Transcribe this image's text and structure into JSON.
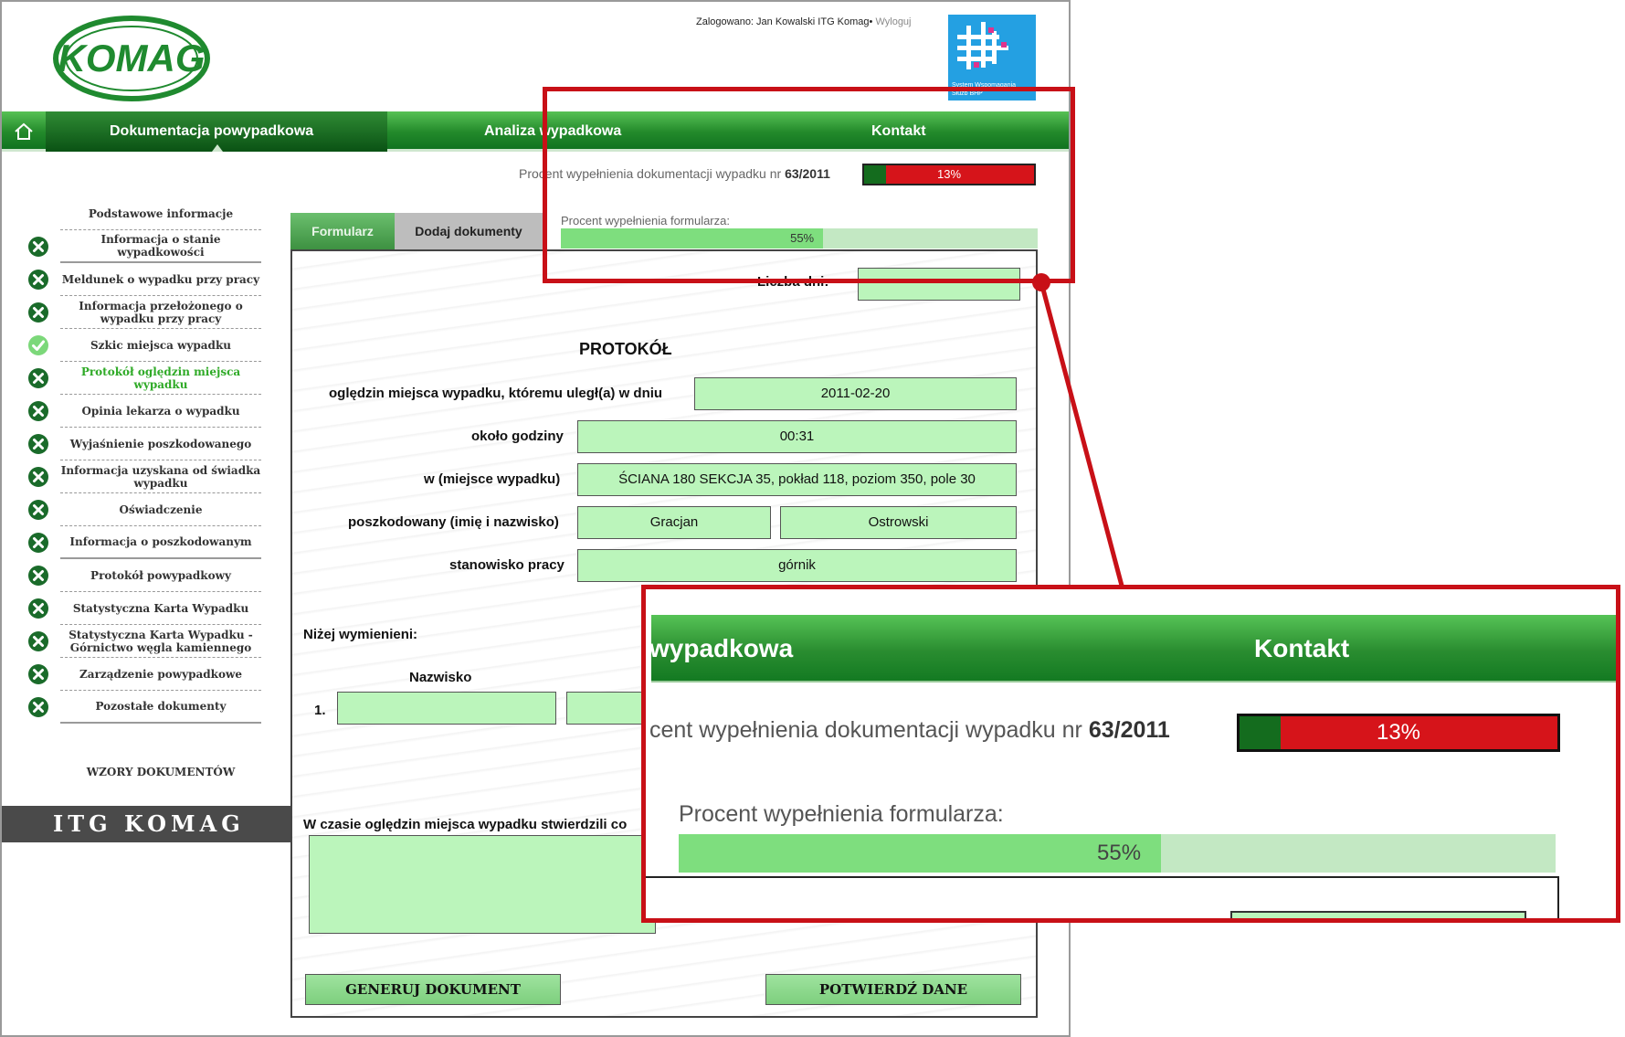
{
  "header": {
    "logo_text": "KOMAG",
    "user_text": "Zalogowano: Jan Kowalski ITG Komag",
    "logout_label": "Wyloguj",
    "system_logo_caption_1": "System Wspomagania",
    "system_logo_caption_2": "Służb BHP"
  },
  "nav": {
    "tabs": [
      {
        "label": "Dokumentacja powypadkowa"
      },
      {
        "label": "Analiza wypadkowa"
      },
      {
        "label": "Kontakt"
      }
    ]
  },
  "doc_progress": {
    "label": "Procent wypełnienia dokumentacji wypadku nr",
    "number": "63/2011",
    "percent_text": "13%",
    "fraction": 0.13
  },
  "sidebar": {
    "items": [
      {
        "label": "Podstawowe informacje",
        "status": "none"
      },
      {
        "label": "Informacja o stanie wypadkowości",
        "status": "x"
      },
      {
        "label": "Meldunek o wypadku przy pracy",
        "status": "x"
      },
      {
        "label": "Informacja przełożonego o wypadku przy pracy",
        "status": "x"
      },
      {
        "label": "Szkic miejsca wypadku",
        "status": "check"
      },
      {
        "label": "Protokół oględzin miejsca wypadku",
        "status": "x"
      },
      {
        "label": "Opinia lekarza o wypadku",
        "status": "x"
      },
      {
        "label": "Wyjaśnienie poszkodowanego",
        "status": "x"
      },
      {
        "label": "Informacja uzyskana od świadka wypadku",
        "status": "x"
      },
      {
        "label": "Oświadczenie",
        "status": "x"
      },
      {
        "label": "Informacja o poszkodowanym",
        "status": "x"
      },
      {
        "label": "Protokół powypadkowy",
        "status": "x"
      },
      {
        "label": "Statystyczna Karta Wypadku",
        "status": "x"
      },
      {
        "label": "Statystyczna Karta Wypadku - Górnictwo węgla kamiennego",
        "status": "x"
      },
      {
        "label": "Zarządzenie powypadkowe",
        "status": "x"
      },
      {
        "label": "Pozostałe dokumenty",
        "status": "x"
      }
    ],
    "wzory_label": "WZORY DOKUMENTÓW",
    "brand_band": "ITG KOMAG"
  },
  "form_tabs": {
    "formularz": "Formularz",
    "dodaj": "Dodaj dokumenty"
  },
  "form_progress": {
    "label": "Procent wypełnienia formularza:",
    "percent_text": "55%",
    "fraction": 0.55
  },
  "form": {
    "liczba_dni_label": "Liczba dni:",
    "liczba_dni_value": "",
    "title": "PROTOKÓŁ",
    "date_label": "oględzin miejsca wypadku, któremu uległ(a) w dniu",
    "date_value": "2011-02-20",
    "time_label": "około godziny",
    "time_value": "00:31",
    "place_label": "w (miejsce wypadku)",
    "place_value": "ŚCIANA 180 SEKCJA 35, pokład 118, poziom 350, pole 30",
    "victim_label": "poszkodowany (imię i nazwisko)",
    "victim_first": "Gracjan",
    "victim_last": "Ostrowski",
    "position_label": "stanowisko pracy",
    "position_value": "górnik",
    "below_label": "Niżej wymienieni:",
    "col_surname": "Nazwisko",
    "row1_index": "1.",
    "row1_surname": "",
    "row1_name": "",
    "findings_label": "W czasie oględzin miejsca wypadku stwierdzili co",
    "findings_value": "",
    "btn_generate": "GENERUJ DOKUMENT",
    "btn_confirm": "POTWIERDŹ DANE"
  },
  "zoom": {
    "tab_fragment": "wypadkowa",
    "tab_kontakt": "Kontakt",
    "doc_label_fragment": "cent wypełnienia dokumentacji wypadku nr",
    "doc_number": "63/2011",
    "doc_percent": "13%",
    "form_label": "Procent wypełnienia formularza:",
    "form_percent": "55%"
  },
  "colors": {
    "nav_green": "#238a2b",
    "field_green": "#bbf5bb",
    "progress_red": "#d6141a",
    "progress_dark_green": "#146c1e",
    "highlight_red": "#c81017",
    "active_sidebar": "#2faa27"
  }
}
